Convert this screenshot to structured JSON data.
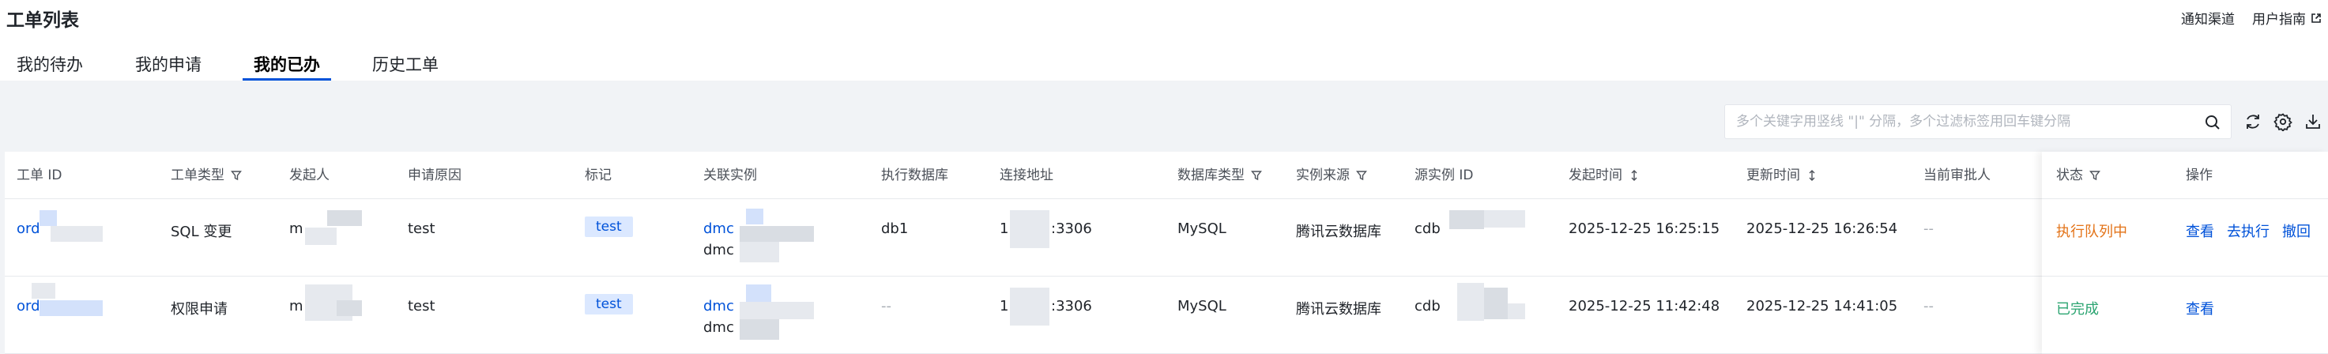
{
  "header": {
    "title": "工单列表",
    "links": [
      {
        "label": "通知渠道"
      },
      {
        "label": "用户指南"
      }
    ]
  },
  "tabs": [
    {
      "label": "我的待办",
      "active": false
    },
    {
      "label": "我的申请",
      "active": false
    },
    {
      "label": "我的已办",
      "active": true
    },
    {
      "label": "历史工单",
      "active": false
    }
  ],
  "search": {
    "placeholder": "多个关键字用竖线 \"|\" 分隔，多个过滤标签用回车键分隔"
  },
  "table": {
    "columns": {
      "order_id": "工单 ID",
      "order_type": "工单类型",
      "initiator": "发起人",
      "reason": "申请原因",
      "mark": "标记",
      "instance": "关联实例",
      "exec_db": "执行数据库",
      "address": "连接地址",
      "db_type": "数据库类型",
      "source": "实例来源",
      "source_id": "源实例 ID",
      "created": "发起时间",
      "updated": "更新时间",
      "approver": "当前审批人",
      "status": "状态",
      "ops": "操作"
    },
    "rows": [
      {
        "order_id": "ord",
        "order_type": "SQL 变更",
        "initiator": "m",
        "reason": "test",
        "mark": "test",
        "instance_line1": "dmc",
        "instance_line2": "dmc",
        "exec_db": "db1",
        "address_prefix": "1",
        "address_port": ":3306",
        "db_type": "MySQL",
        "source": "腾讯云数据库",
        "source_id": "cdb",
        "created": "2025-12-25 16:25:15",
        "updated": "2025-12-25 16:26:54",
        "approver": "--",
        "status": "执行队列中",
        "status_color": "#e37318",
        "actions": [
          "查看",
          "去执行",
          "撤回"
        ]
      },
      {
        "order_id": "ord",
        "order_type": "权限申请",
        "initiator": "m",
        "reason": "test",
        "mark": "test",
        "instance_line1": "dmc",
        "instance_line2": "dmc",
        "exec_db": "--",
        "address_prefix": "1",
        "address_port": ":3306",
        "db_type": "MySQL",
        "source": "腾讯云数据库",
        "source_id": "cdb",
        "created": "2025-12-25 11:42:48",
        "updated": "2025-12-25 14:41:05",
        "approver": "--",
        "status": "已完成",
        "status_color": "#2ba471",
        "actions": [
          "查看"
        ]
      }
    ]
  },
  "colors": {
    "primary": "#0052d9",
    "tag_bg": "#dbe8ff",
    "background_gray": "#f1f3f6"
  }
}
